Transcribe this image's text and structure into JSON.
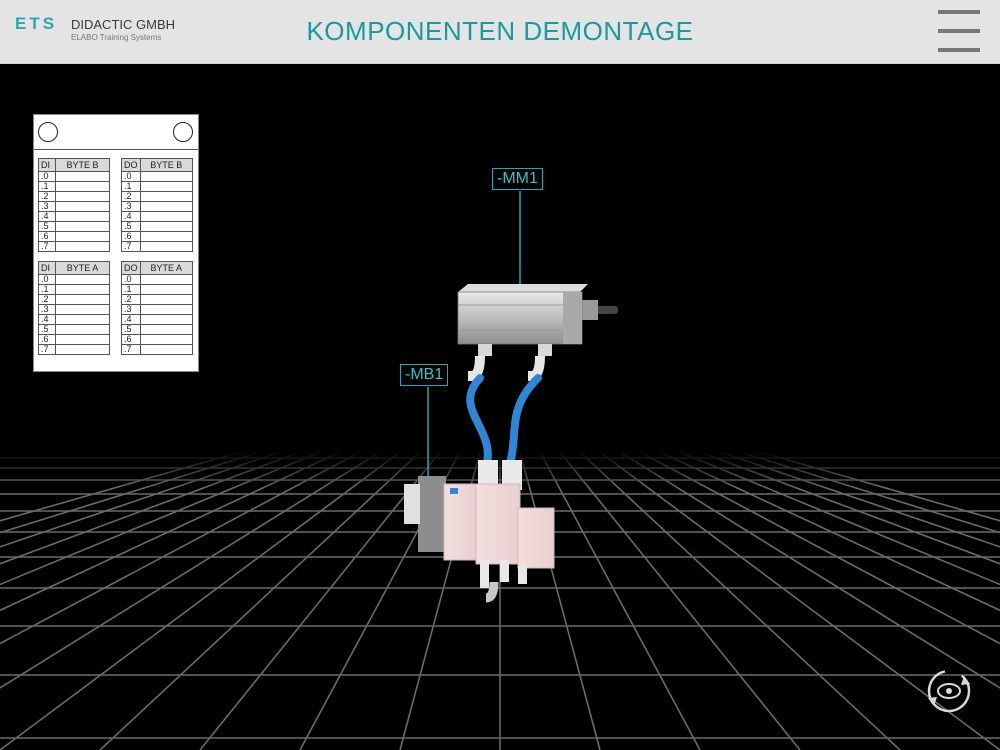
{
  "header": {
    "logo_mark": "ETS",
    "company": "DIDACTIC GMBH",
    "subtitle": "ELABO Training Systems",
    "title": "KOMPONENTEN DEMONTAGE"
  },
  "io_panel": {
    "tables": [
      {
        "head_left": "DI",
        "head_right": "BYTE B",
        "bits": [
          ".0",
          ".1",
          ".2",
          ".3",
          ".4",
          ".5",
          ".6",
          ".7"
        ]
      },
      {
        "head_left": "DO",
        "head_right": "BYTE B",
        "bits": [
          ".0",
          ".1",
          ".2",
          ".3",
          ".4",
          ".5",
          ".6",
          ".7"
        ]
      },
      {
        "head_left": "DI",
        "head_right": "BYTE A",
        "bits": [
          ".0",
          ".1",
          ".2",
          ".3",
          ".4",
          ".5",
          ".6",
          ".7"
        ]
      },
      {
        "head_left": "DO",
        "head_right": "BYTE A",
        "bits": [
          ".0",
          ".1",
          ".2",
          ".3",
          ".4",
          ".5",
          ".6",
          ".7"
        ]
      }
    ]
  },
  "labels": {
    "cylinder": "-MM1",
    "valve": "-MB1"
  },
  "icons": {
    "menu": "hamburger-menu-icon",
    "rotate": "rotate-view-icon"
  },
  "colors": {
    "accent": "#1a9aa0",
    "header_bg": "#e4e4e4",
    "tube": "#2f86d6"
  }
}
